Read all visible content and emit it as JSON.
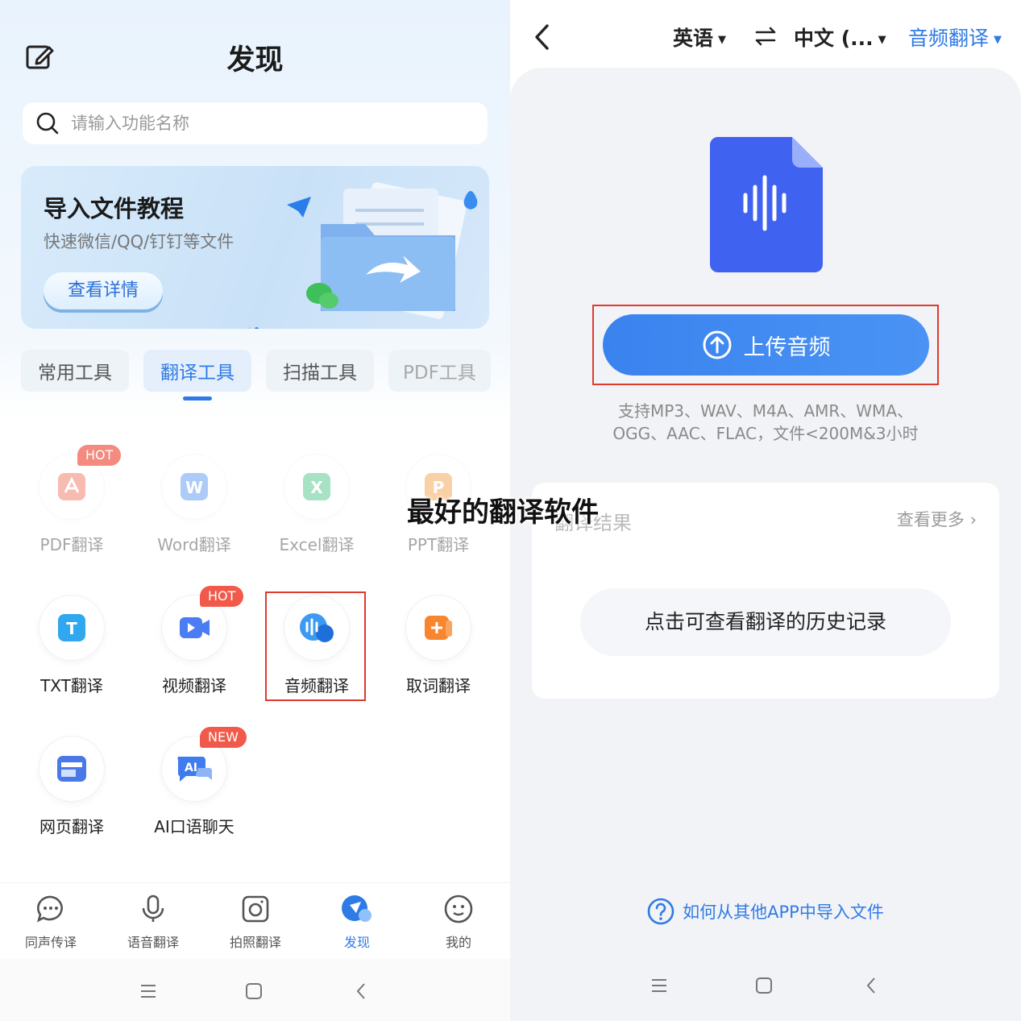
{
  "left": {
    "title": "发现",
    "search_placeholder": "请输入功能名称",
    "banner": {
      "title": "导入文件教程",
      "subtitle": "快速微信/QQ/钉钉等文件",
      "button": "查看详情"
    },
    "tabs": [
      "常用工具",
      "翻译工具",
      "扫描工具",
      "PDF工具"
    ],
    "active_tab": "翻译工具",
    "tools": [
      {
        "label": "PDF翻译",
        "badge": "HOT",
        "icon": "pdf-icon",
        "color": "#f06a55"
      },
      {
        "label": "Word翻译",
        "badge": "",
        "icon": "word-icon",
        "color": "#4b8ef0"
      },
      {
        "label": "Excel翻译",
        "badge": "",
        "icon": "excel-icon",
        "color": "#3fbf7f"
      },
      {
        "label": "PPT翻译",
        "badge": "",
        "icon": "ppt-icon",
        "color": "#f59a3b"
      },
      {
        "label": "TXT翻译",
        "badge": "",
        "icon": "txt-icon",
        "color": "#2fa8f0"
      },
      {
        "label": "视频翻译",
        "badge": "HOT",
        "icon": "video-icon",
        "color": "#4a7cf2"
      },
      {
        "label": "音频翻译",
        "badge": "",
        "icon": "audio-icon",
        "color": "#3d9af2"
      },
      {
        "label": "取词翻译",
        "badge": "",
        "icon": "word-pick-icon",
        "color": "#f7862f"
      },
      {
        "label": "网页翻译",
        "badge": "",
        "icon": "webpage-icon",
        "color": "#4b78e8"
      },
      {
        "label": "AI口语聊天",
        "badge": "NEW",
        "icon": "ai-chat-icon",
        "color": "#3e7cf0"
      }
    ],
    "nav": [
      {
        "label": "同声传译",
        "icon": "chat-bubble-icon"
      },
      {
        "label": "语音翻译",
        "icon": "microphone-icon"
      },
      {
        "label": "拍照翻译",
        "icon": "camera-icon"
      },
      {
        "label": "发现",
        "icon": "discover-icon"
      },
      {
        "label": "我的",
        "icon": "profile-icon"
      }
    ],
    "active_nav": "发现"
  },
  "right": {
    "source_lang": "英语",
    "target_lang": "中文 (...",
    "mode": "音频翻译",
    "upload_button": "上传音频",
    "formats_line1": "支持MP3、WAV、M4A、AMR、WMA、",
    "formats_line2": "OGG、AAC、FLAC，文件<200M&3小时",
    "result_title": "翻译结果",
    "more_link": "查看更多",
    "history_button": "点击可查看翻译的历史记录",
    "help_link": "如何从其他APP中导入文件"
  },
  "overlay_title": "最好的翻译软件",
  "colors": {
    "accent": "#2f7be6",
    "badge": "#f15a4a",
    "highlight": "#e03a2f"
  }
}
